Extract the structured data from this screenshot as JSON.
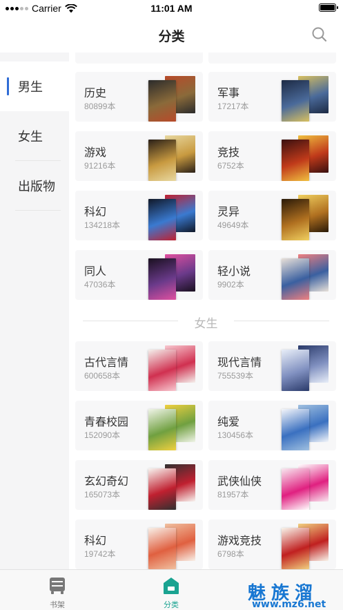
{
  "status_bar": {
    "carrier": "Carrier",
    "time": "11:01 AM"
  },
  "nav": {
    "title": "分类",
    "search_icon": "search-icon"
  },
  "sidebar": {
    "items": [
      {
        "label": "男生",
        "active": true
      },
      {
        "label": "女生",
        "active": false
      },
      {
        "label": "出版物",
        "active": false
      }
    ]
  },
  "male": {
    "categories": [
      {
        "name": "历史",
        "count": "80899本"
      },
      {
        "name": "军事",
        "count": "17217本"
      },
      {
        "name": "游戏",
        "count": "91216本"
      },
      {
        "name": "竞技",
        "count": "6752本"
      },
      {
        "name": "科幻",
        "count": "134218本"
      },
      {
        "name": "灵异",
        "count": "49649本"
      },
      {
        "name": "同人",
        "count": "47036本"
      },
      {
        "name": "轻小说",
        "count": "9902本"
      }
    ]
  },
  "female": {
    "section_label": "女生",
    "categories": [
      {
        "name": "古代言情",
        "count": "600658本"
      },
      {
        "name": "现代言情",
        "count": "755539本"
      },
      {
        "name": "青春校园",
        "count": "152090本"
      },
      {
        "name": "纯爱",
        "count": "130456本"
      },
      {
        "name": "玄幻奇幻",
        "count": "165073本"
      },
      {
        "name": "武侠仙侠",
        "count": "81957本"
      },
      {
        "name": "科幻",
        "count": "19742本"
      },
      {
        "name": "游戏竞技",
        "count": "6798本"
      }
    ]
  },
  "tab_bar": {
    "tabs": [
      {
        "label": "书架",
        "icon": "bookshelf-icon",
        "active": false
      },
      {
        "label": "分类",
        "icon": "category-icon",
        "active": true
      }
    ]
  },
  "watermark": {
    "text": "魅族溜",
    "url": "www.mz6.net"
  },
  "colors": {
    "accent": "#1aa391",
    "sidebar_active_bar": "#2f6cd6",
    "watermark": "#1877d2"
  }
}
